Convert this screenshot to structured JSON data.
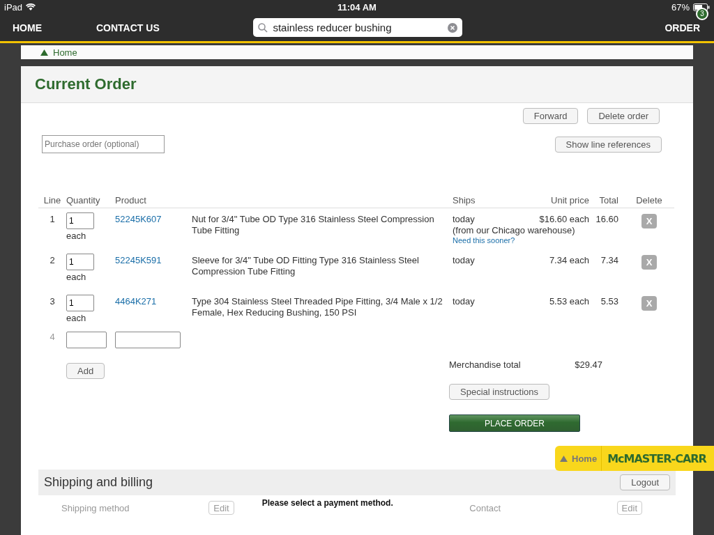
{
  "status_bar": {
    "device": "iPad",
    "time": "11:04 AM",
    "battery": "67%"
  },
  "nav": {
    "items": [
      "HOME",
      "CONTACT US"
    ],
    "search": {
      "value": "stainless reducer bushing"
    },
    "order": {
      "label": "ORDER",
      "count": "3"
    }
  },
  "breadcrumb": "Home",
  "title": "Current Order",
  "actions": [
    "Forward",
    "Delete order"
  ],
  "purchase_order": {
    "placeholder": "Purchase order (optional)"
  },
  "line_refs_button": "Show line references",
  "table": {
    "columns": [
      "Line",
      "Quantity",
      "Product",
      "Ships",
      "Unit price",
      "Total",
      "Delete"
    ],
    "rows": [
      {
        "line": "1",
        "quantity": "1",
        "unit": "each",
        "product": "52245K607",
        "description": "Nut for 3/4\" Tube OD Type 316 Stainless Steel Compression Tube Fitting",
        "ships": "today",
        "ships_detail": "(from our Chicago warehouse)",
        "ships_link": "Need this sooner?",
        "unit_price": "$16.60 each",
        "total": "16.60",
        "delete": "X"
      },
      {
        "line": "2",
        "quantity": "1",
        "unit": "each",
        "product": "52245K591",
        "description": "Sleeve for 3/4\" Tube OD Fitting Type 316 Stainless Steel Compression Tube Fitting",
        "ships": "today",
        "unit_price": "7.34 each",
        "total": "7.34",
        "delete": "X"
      },
      {
        "line": "3",
        "quantity": "1",
        "unit": "each",
        "product": "4464K271",
        "description": "Type 304 Stainless Steel Threaded Pipe Fitting, 3/4 Male x 1/2 Female, Hex Reducing Bushing, 150 PSI",
        "ships": "today",
        "unit_price": "5.53 each",
        "total": "5.53",
        "delete": "X"
      }
    ],
    "new_line": "4",
    "add_button": "Add"
  },
  "merchandise_total": {
    "label": "Merchandise total",
    "value": "$29.47"
  },
  "special_instructions": "Special instructions",
  "place_order": "PLACE ORDER",
  "floating_home": {
    "label": "Home",
    "logo": "McMASTER-CARR"
  },
  "shipping": {
    "title": "Shipping and billing",
    "logout": "Logout",
    "notice": "Please select a payment method.",
    "sections": [
      {
        "label": "Shipping method",
        "edit": "Edit"
      },
      {
        "label": "Contact",
        "edit": "Edit"
      }
    ]
  }
}
